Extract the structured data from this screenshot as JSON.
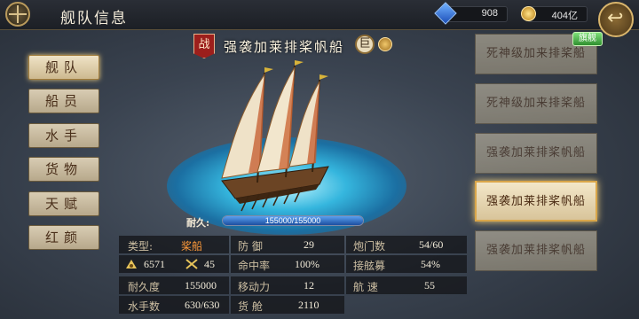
{
  "header": {
    "title": "舰队信息",
    "gems": "908",
    "gold": "404亿",
    "colors": {
      "bar": "#1c1f25",
      "accent": "#d9b56c"
    }
  },
  "menu": {
    "items": [
      {
        "label": "舰队",
        "active": true
      },
      {
        "label": "船员",
        "active": false
      },
      {
        "label": "水手",
        "active": false
      },
      {
        "label": "货物",
        "active": false
      },
      {
        "label": "天赋",
        "active": false
      },
      {
        "label": "红颜",
        "active": false
      }
    ]
  },
  "ship": {
    "badge": "战",
    "name": "强袭加莱排桨帆船",
    "size_badge": "巨",
    "durability_label": "耐久:",
    "durability_text": "155000/155000",
    "durability_fraction": 1.0
  },
  "stats": {
    "type_label": "类型:",
    "type_value": "桨船",
    "sailors": "6571",
    "swords": "45",
    "durability_label": "耐久度",
    "durability_value": "155000",
    "crew_label": "水手数",
    "crew_value": "630/630",
    "defense_label": "防 御",
    "defense_value": "29",
    "hit_label": "命中率",
    "hit_value": "100%",
    "move_label": "移动力",
    "move_value": "12",
    "cargo_label": "货 舱",
    "cargo_value": "2110",
    "cannon_label": "炮门数",
    "cannon_value": "54/60",
    "board_label": "接舷募",
    "board_value": "54%",
    "speed_label": "航 速",
    "speed_value": "55"
  },
  "ship_list": {
    "flag_label": "旗舰",
    "items": [
      {
        "label": "死神级加来排桨船",
        "selected": false
      },
      {
        "label": "死神级加来排桨船",
        "selected": false
      },
      {
        "label": "强袭加莱排桨帆船",
        "selected": false
      },
      {
        "label": "强袭加莱排桨帆船",
        "selected": true
      },
      {
        "label": "强袭加莱排桨帆船",
        "selected": false
      }
    ]
  }
}
